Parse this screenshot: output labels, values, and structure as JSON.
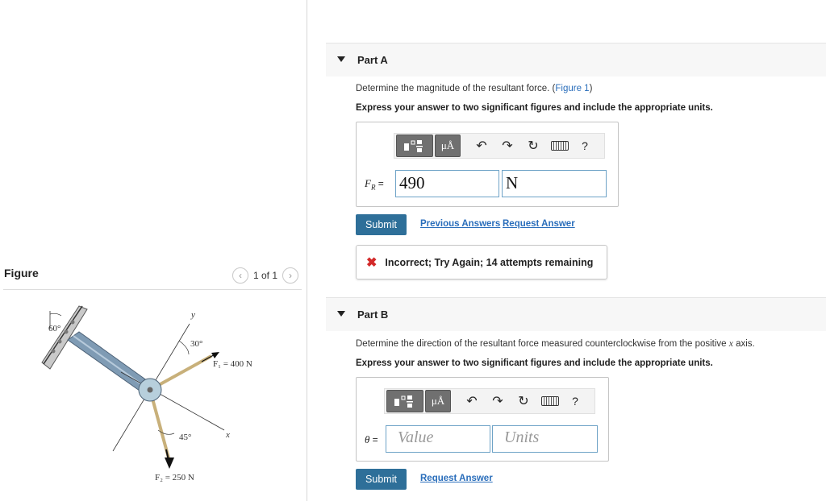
{
  "figure": {
    "title": "Figure",
    "pager_text": "1 of 1",
    "labels": {
      "angle_wall": "60°",
      "y_axis": "y",
      "angle_f1": "30°",
      "f1": "F₁ = 400 N",
      "angle_f2": "45°",
      "x_axis": "x",
      "f2": "F₂ = 250 N"
    }
  },
  "part_a": {
    "title": "Part A",
    "question_text": "Determine the magnitude of the resultant force. (",
    "question_link": "Figure 1",
    "question_end": ")",
    "instruction": "Express your answer to two significant figures and include the appropriate units.",
    "field_label": "F",
    "field_sub": "R",
    "field_eq": "=",
    "value": "490",
    "units": "N",
    "submit": "Submit",
    "previous_answers": "Previous Answers",
    "request_answer": "Request Answer",
    "feedback": "Incorrect; Try Again; 14 attempts remaining"
  },
  "part_b": {
    "title": "Part B",
    "question_text": "Determine the direction of the resultant force measured counterclockwise from the positive",
    "question_var": "x",
    "question_end": "axis.",
    "instruction": "Express your answer to two significant figures and include the appropriate units.",
    "field_label": "θ",
    "field_eq": "=",
    "value_placeholder": "Value",
    "units_placeholder": "Units",
    "submit": "Submit",
    "request_answer": "Request Answer"
  },
  "toolbar": {
    "mu_label": "μÅ",
    "help_label": "?"
  }
}
